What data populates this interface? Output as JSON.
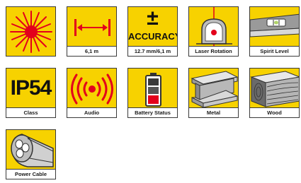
{
  "tiles": [
    {
      "name": "laser-icon",
      "caption": ""
    },
    {
      "name": "range-icon",
      "caption": "6,1 m"
    },
    {
      "name": "accuracy-icon",
      "caption": "12.7 mm/6,1 m",
      "symbol": "±",
      "title": "ACCURACY"
    },
    {
      "name": "laser-rotation-icon",
      "caption": "Laser Rotation"
    },
    {
      "name": "spirit-level-icon",
      "caption": "Spirit Level"
    },
    {
      "name": "ip-class-icon",
      "caption": "Class",
      "title": "IP54"
    },
    {
      "name": "audio-icon",
      "caption": "Audio"
    },
    {
      "name": "battery-status-icon",
      "caption": "Battery Status"
    },
    {
      "name": "metal-icon",
      "caption": "Metal"
    },
    {
      "name": "wood-icon",
      "caption": "Wood"
    },
    {
      "name": "power-cable-icon",
      "caption": "Power Cable"
    }
  ],
  "colors": {
    "tile_bg": "#f7d200",
    "accent_red": "#e3001b",
    "border": "#3a3a3a"
  }
}
